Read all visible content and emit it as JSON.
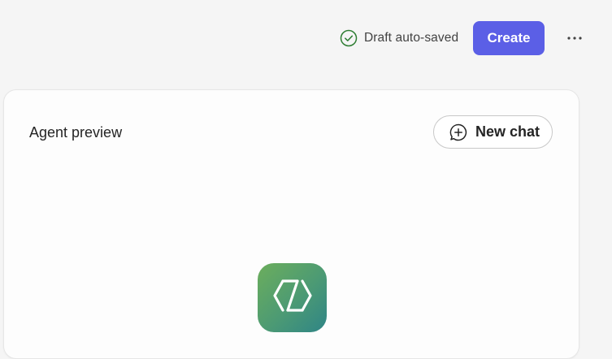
{
  "header": {
    "status_text": "Draft auto-saved",
    "status_icon": "check-circle-icon",
    "create_label": "Create",
    "more_icon": "more-horizontal-icon"
  },
  "preview": {
    "title": "Agent preview",
    "new_chat_label": "New chat",
    "new_chat_icon": "chat-add-icon",
    "agent_icon": "code-brackets-icon"
  },
  "colors": {
    "accent": "#5b5fe6",
    "status_green": "#2e7d32",
    "logo_gradient_start": "#6cae5c",
    "logo_gradient_end": "#2f8586"
  }
}
